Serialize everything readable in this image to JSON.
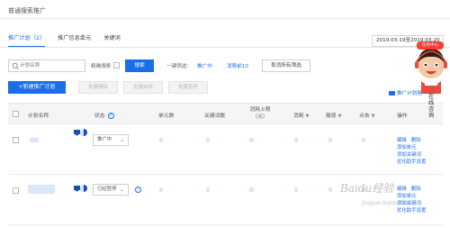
{
  "page": {
    "title": "普通搜索推广"
  },
  "tabs": [
    {
      "label": "推广计划（2）",
      "active": true
    },
    {
      "label": "推广信息单元",
      "active": false
    },
    {
      "label": "关键词",
      "active": false
    }
  ],
  "date_range": "2019-03-19至2019-03-20",
  "toolbar": {
    "search_placeholder": "计划名称",
    "exact_search_label": "精确搜索",
    "search_button": "搜索",
    "quick_filter_label": "一键筛选：",
    "filter_options": [
      "推广中",
      "消费前10"
    ],
    "clear_filter_button": "取消所有筛选"
  },
  "actions": {
    "new_plan": "+新建推广计划",
    "batch_delete": "批量删除",
    "batch_enable": "批量启用",
    "batch_pause": "批量暂停",
    "plan_report": "推广计划报"
  },
  "table": {
    "headers": {
      "plan_name": "计划名称",
      "status": "状态",
      "units": "单元数",
      "keywords": "关键词数",
      "budget_line1": "消耗上限",
      "budget_line2": "（元）",
      "consume": "消耗",
      "impressions": "展现",
      "clicks": "点击",
      "ops": "操作"
    },
    "rows": [
      {
        "status": "推广中",
        "ops": [
          "编辑",
          "删除",
          "添加单元",
          "添加关键词",
          "优化助手设置"
        ]
      },
      {
        "status": "已经暂停",
        "ops": [
          "编辑",
          "删除",
          "添加单元",
          "添加关键词",
          "优化助手设置"
        ]
      }
    ]
  },
  "floating_widget": {
    "badge": "任务中心",
    "online_label": "在线咨询"
  },
  "watermark": {
    "main": "Baidu经验",
    "sub": "jingyan.baidu.com"
  },
  "colors": {
    "primary": "#1a6ee8",
    "header_bg": "#f4f5f7",
    "disabled_text": "#bbbbbb"
  }
}
